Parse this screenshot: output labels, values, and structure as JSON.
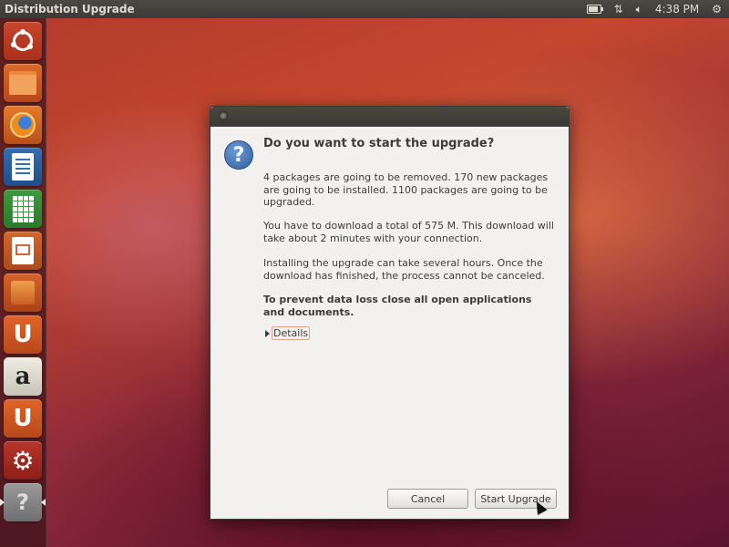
{
  "top_panel": {
    "window_title": "Distribution Upgrade",
    "clock": "4:38 PM",
    "battery_level": 0.8,
    "network_icon": "network-arrows-icon",
    "volume_icon": "speaker-icon",
    "settings_icon": "gear-icon"
  },
  "launcher": {
    "items": [
      {
        "name": "dash-home",
        "icon": "ubuntu-logo-icon"
      },
      {
        "name": "home-folder",
        "icon": "folder-icon"
      },
      {
        "name": "firefox",
        "icon": "firefox-icon"
      },
      {
        "name": "libreoffice-writer",
        "icon": "writer-icon"
      },
      {
        "name": "libreoffice-calc",
        "icon": "calc-icon"
      },
      {
        "name": "libreoffice-impress",
        "icon": "impress-icon"
      },
      {
        "name": "ubuntu-software-center",
        "icon": "shopping-bag-icon"
      },
      {
        "name": "ubuntu-one",
        "icon": "ubuntu-one-icon"
      },
      {
        "name": "amazon",
        "icon": "amazon-icon"
      },
      {
        "name": "ubuntu-one-music",
        "icon": "ubuntu-one-icon"
      },
      {
        "name": "system-settings",
        "icon": "settings-icon"
      },
      {
        "name": "software-updater",
        "icon": "question-icon"
      }
    ],
    "glyphs": {
      "u": "U",
      "a": "a",
      "gear": "⚙",
      "q": "?"
    }
  },
  "dialog": {
    "icon": "question-icon",
    "icon_glyph": "?",
    "heading": "Do you want to start the upgrade?",
    "paragraph_1": "4 packages are going to be removed. 170 new packages are going to be installed. 1100 packages are going to be upgraded.",
    "paragraph_2": "You have to download a total of 575 M. This download will take about 2 minutes with your connection.",
    "paragraph_3": "Installing the upgrade can take several hours. Once the download has finished, the process cannot be canceled.",
    "paragraph_4": "To prevent data loss close all open applications and documents.",
    "details_label": "Details",
    "cancel_label": "Cancel",
    "start_label": "Start Upgrade"
  }
}
